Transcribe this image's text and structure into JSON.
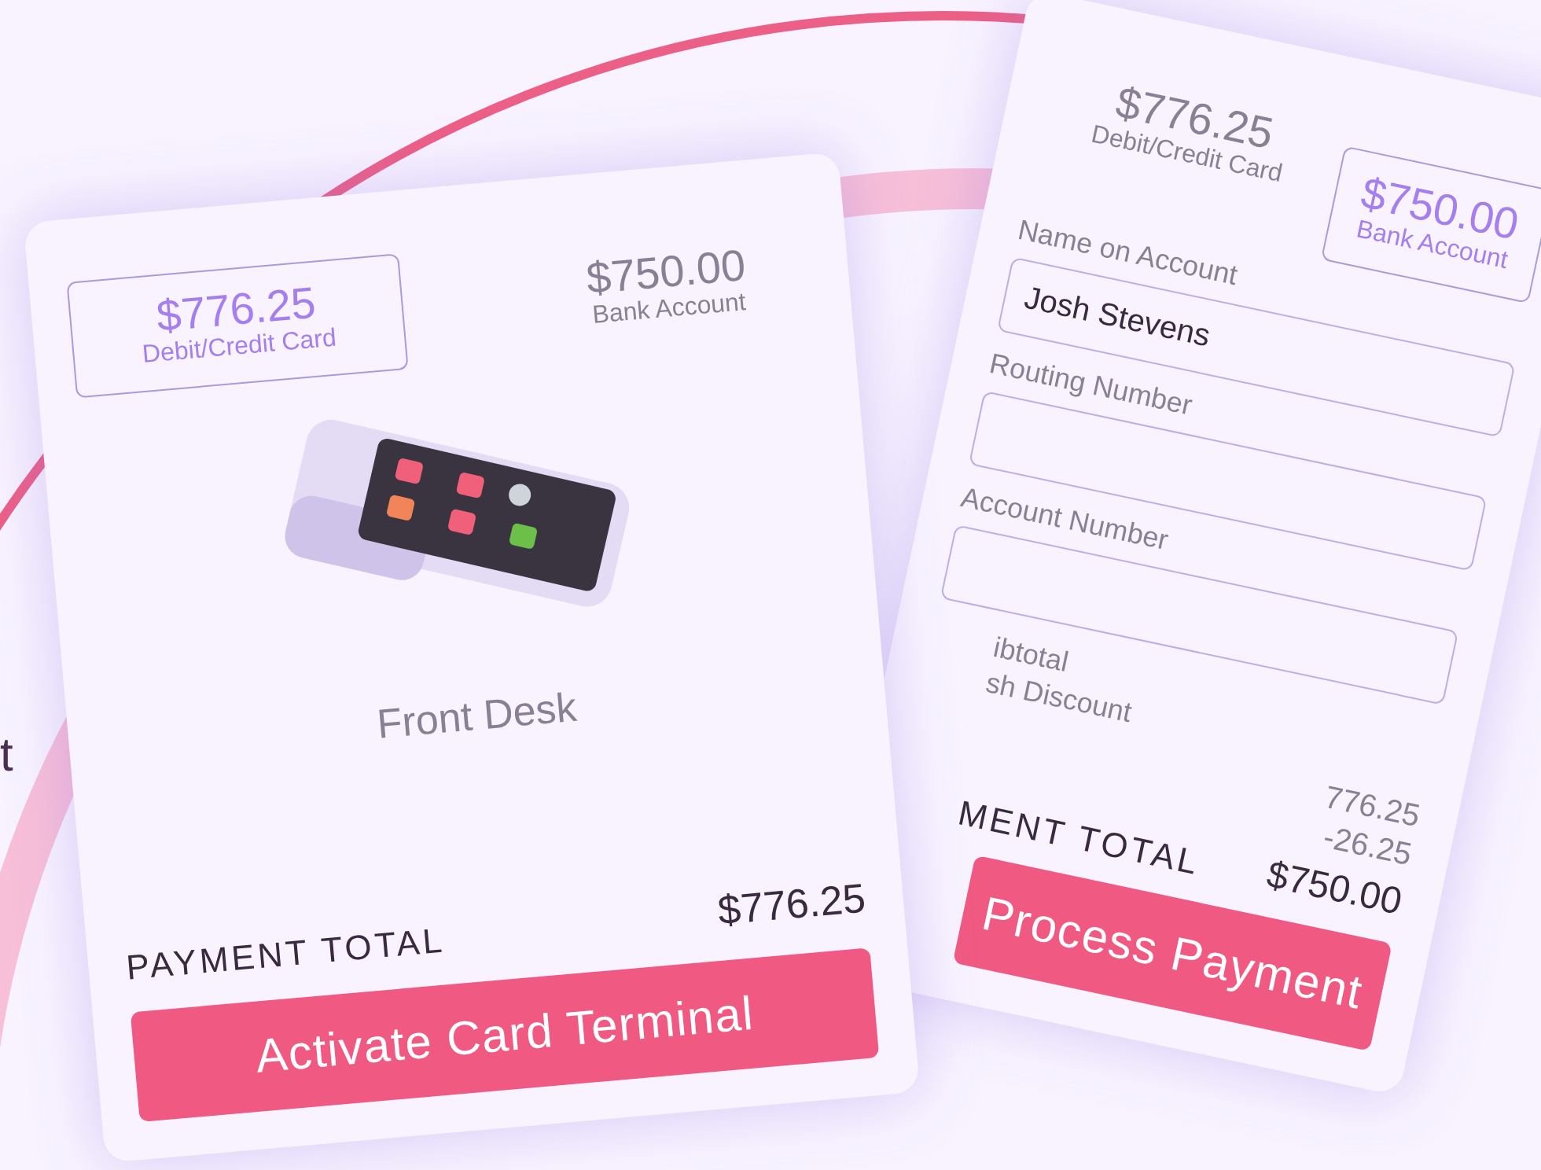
{
  "background_text": "t",
  "left_card": {
    "payment_options": [
      {
        "amount": "$776.25",
        "label": "Debit/Credit Card",
        "selected": true
      },
      {
        "amount": "$750.00",
        "label": "Bank Account",
        "selected": false
      }
    ],
    "terminal_name": "Front Desk",
    "total_label": "PAYMENT TOTAL",
    "total": "$776.25",
    "button": "Activate Card Terminal"
  },
  "right_card": {
    "payment_options": [
      {
        "amount": "$776.25",
        "label": "Debit/Credit Card",
        "selected": false
      },
      {
        "amount": "$750.00",
        "label": "Bank Account",
        "selected": true
      }
    ],
    "fields": [
      {
        "label": "Name on Account",
        "value": "Josh Stevens"
      },
      {
        "label": "Routing Number"
      },
      {
        "label": "Account Number"
      }
    ],
    "summary": [
      {
        "label": "ibtotal",
        "value": "776.25"
      },
      {
        "label": "sh Discount",
        "value": "-26.25"
      }
    ],
    "total_label": "MENT TOTAL",
    "total": "$750.00",
    "button": "Process Payment"
  }
}
